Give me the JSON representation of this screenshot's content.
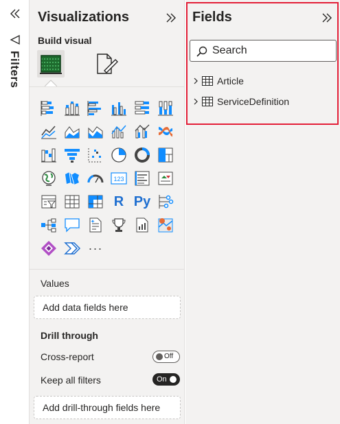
{
  "filters": {
    "label": "Filters"
  },
  "visualizations": {
    "title": "Visualizations",
    "build_visual": "Build visual",
    "icons": [
      "stacked-bar-chart-icon",
      "stacked-column-chart-icon",
      "clustered-bar-chart-icon",
      "clustered-column-chart-icon",
      "100-stacked-bar-chart-icon",
      "100-stacked-column-chart-icon",
      "line-chart-icon",
      "area-chart-icon",
      "stacked-area-chart-icon",
      "line-and-stacked-column-chart-icon",
      "line-and-clustered-column-chart-icon",
      "ribbon-chart-icon",
      "waterfall-chart-icon",
      "funnel-chart-icon",
      "scatter-chart-icon",
      "pie-chart-icon",
      "donut-chart-icon",
      "treemap-icon",
      "map-icon",
      "filled-map-icon",
      "gauge-icon",
      "card-icon",
      "multi-row-card-icon",
      "kpi-icon",
      "slicer-icon",
      "table-icon",
      "matrix-icon",
      "r-script-visual-icon",
      "python-visual-icon",
      "key-influencers-icon",
      "decomposition-tree-icon",
      "qa-visual-icon",
      "smart-narrative-icon",
      "metrics-icon",
      "paginated-report-icon",
      "azure-map-icon",
      "power-apps-icon",
      "power-automate-icon",
      "more-visuals-icon"
    ],
    "r_label": "R",
    "py_label": "Py",
    "more_label": "···",
    "values_label": "Values",
    "values_placeholder": "Add data fields here",
    "drill_through": "Drill through",
    "cross_report": "Cross-report",
    "cross_report_state": "Off",
    "keep_all_filters": "Keep all filters",
    "keep_all_filters_state": "On",
    "drill_placeholder": "Add drill-through fields here"
  },
  "fields": {
    "title": "Fields",
    "search_placeholder": "Search",
    "tables": [
      {
        "name": "Article"
      },
      {
        "name": "ServiceDefinition"
      }
    ]
  },
  "colors": {
    "highlight_border": "#e31e37",
    "pane_bg": "#f3f2f1",
    "accent_yellow": "#f2c811",
    "accent_blue": "#118dff"
  }
}
